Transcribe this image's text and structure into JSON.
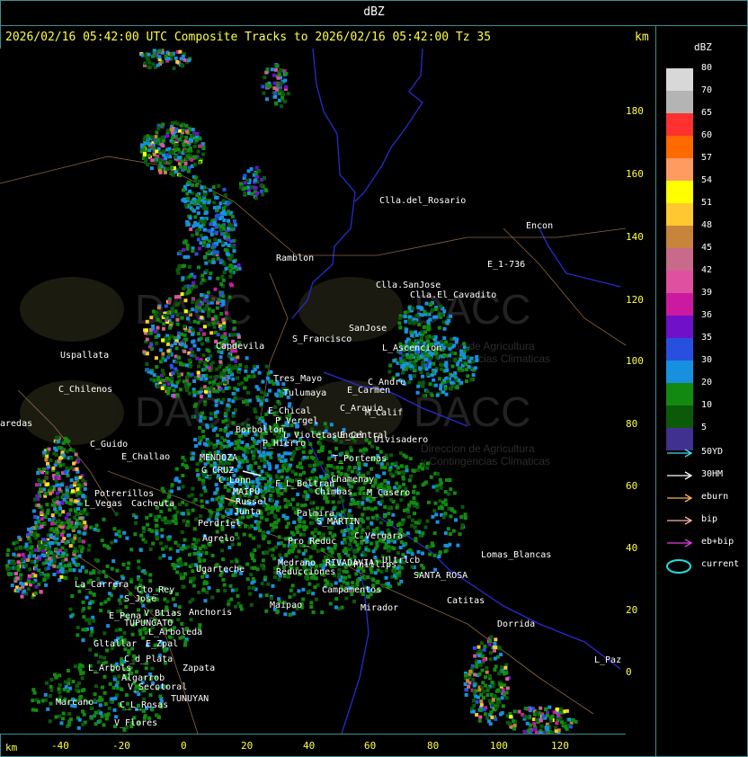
{
  "header": {
    "title": "dBZ"
  },
  "map_title": "2026/02/16 05:42:00 UTC Composite Tracks to 2026/02/16 05:42:00 Tz 35",
  "km_top": "km",
  "km_bottom": "km",
  "y_ticks": [
    "180",
    "160",
    "140",
    "120",
    "100",
    "80",
    "60",
    "40",
    "20",
    "0"
  ],
  "x_ticks": [
    "-40",
    "-20",
    "0",
    "20",
    "40",
    "60",
    "80",
    "100",
    "120"
  ],
  "legend": {
    "title": "dBZ",
    "levels": [
      {
        "label": "80",
        "color": "#d8d8d8"
      },
      {
        "label": "70",
        "color": "#b4b4b4"
      },
      {
        "label": "65",
        "color": "#ff3030"
      },
      {
        "label": "60",
        "color": "#ff6a00"
      },
      {
        "label": "57",
        "color": "#ff9a60"
      },
      {
        "label": "54",
        "color": "#ffff00"
      },
      {
        "label": "51",
        "color": "#ffc830"
      },
      {
        "label": "48",
        "color": "#c8843a"
      },
      {
        "label": "45",
        "color": "#c86a8a"
      },
      {
        "label": "42",
        "color": "#e050a0"
      },
      {
        "label": "39",
        "color": "#cc1aa0"
      },
      {
        "label": "36",
        "color": "#7010c8"
      },
      {
        "label": "35",
        "color": "#2850e0"
      },
      {
        "label": "30",
        "color": "#1890e0"
      },
      {
        "label": "20",
        "color": "#128a12"
      },
      {
        "label": "10",
        "color": "#0a5a0a"
      },
      {
        "label": "5",
        "color": "#403090"
      }
    ],
    "tracks": [
      {
        "label": "50YD",
        "color": "#40e0e0"
      },
      {
        "label": "30HM",
        "color": "#ffffff"
      },
      {
        "label": "eburn",
        "color": "#ffb060"
      },
      {
        "label": "bip",
        "color": "#ffb0b0"
      },
      {
        "label": "eb+bip",
        "color": "#e040e0"
      },
      {
        "label": "current",
        "color": "#20e0e0"
      }
    ]
  },
  "places": [
    "Clla.del_Rosario",
    "Encon",
    "E_1-736",
    "Ramblon",
    "Clla.SanJose",
    "Clla.El_Cavadito",
    "S_Francisco",
    "SanJose",
    "L_Ascencion",
    "Uspallata",
    "Capdevila",
    "Tres_Mayo",
    "Tulumaya",
    "C_Andre",
    "E_Carmen",
    "C_Chilenos",
    "E_Chical",
    "P_Vergel",
    "C_Arauio",
    "M_Calif",
    "Divisadero",
    "Uncal",
    "E_Central",
    "C_Guido",
    "E_Challao",
    "MENDOZA",
    "Borbollon",
    "P_Hierro",
    "L_Violetas",
    "T_Portenas",
    "Chamenay",
    "G_CRUZ",
    "C_Lonn",
    "F_L_Beltran",
    "Chimbas",
    "M_Casero",
    "Potrerillos",
    "Cacheuta",
    "MAIPU",
    "Russel",
    "L_Vegas",
    "Perdriel",
    "Agrelo",
    "Junta",
    "S_MARTIN",
    "C_Vergara",
    "Reducciones",
    "Medrano",
    "Palmira",
    "Pro_Reduc",
    "Ugarteche",
    "RIVADAVIA",
    "Phillips",
    "Ultrlcb",
    "Lomas_Blancas",
    "Catitas",
    "La_Carrera",
    "Cto_Rey",
    "S_Jose",
    "SANTA_ROSA",
    "Campamentos",
    "Dorrida",
    "L_Paz",
    "E_Pena",
    "V_Btias",
    "Anchoris",
    "Mirador",
    "TUPUNGATO",
    "L_Arboleda",
    "Gltallar",
    "E_Zpal",
    "C_d_Plata",
    "L_Arbols",
    "Zapata",
    "Algarrob",
    "V_Secotoral",
    "TUNUYAN",
    "Marcano",
    "C_L_Rosas",
    "V_Flores",
    "aredas",
    "Maipao"
  ],
  "logo_text": [
    "DACC",
    "Direccion de Agricultura",
    "y Contingencias Climaticas"
  ]
}
